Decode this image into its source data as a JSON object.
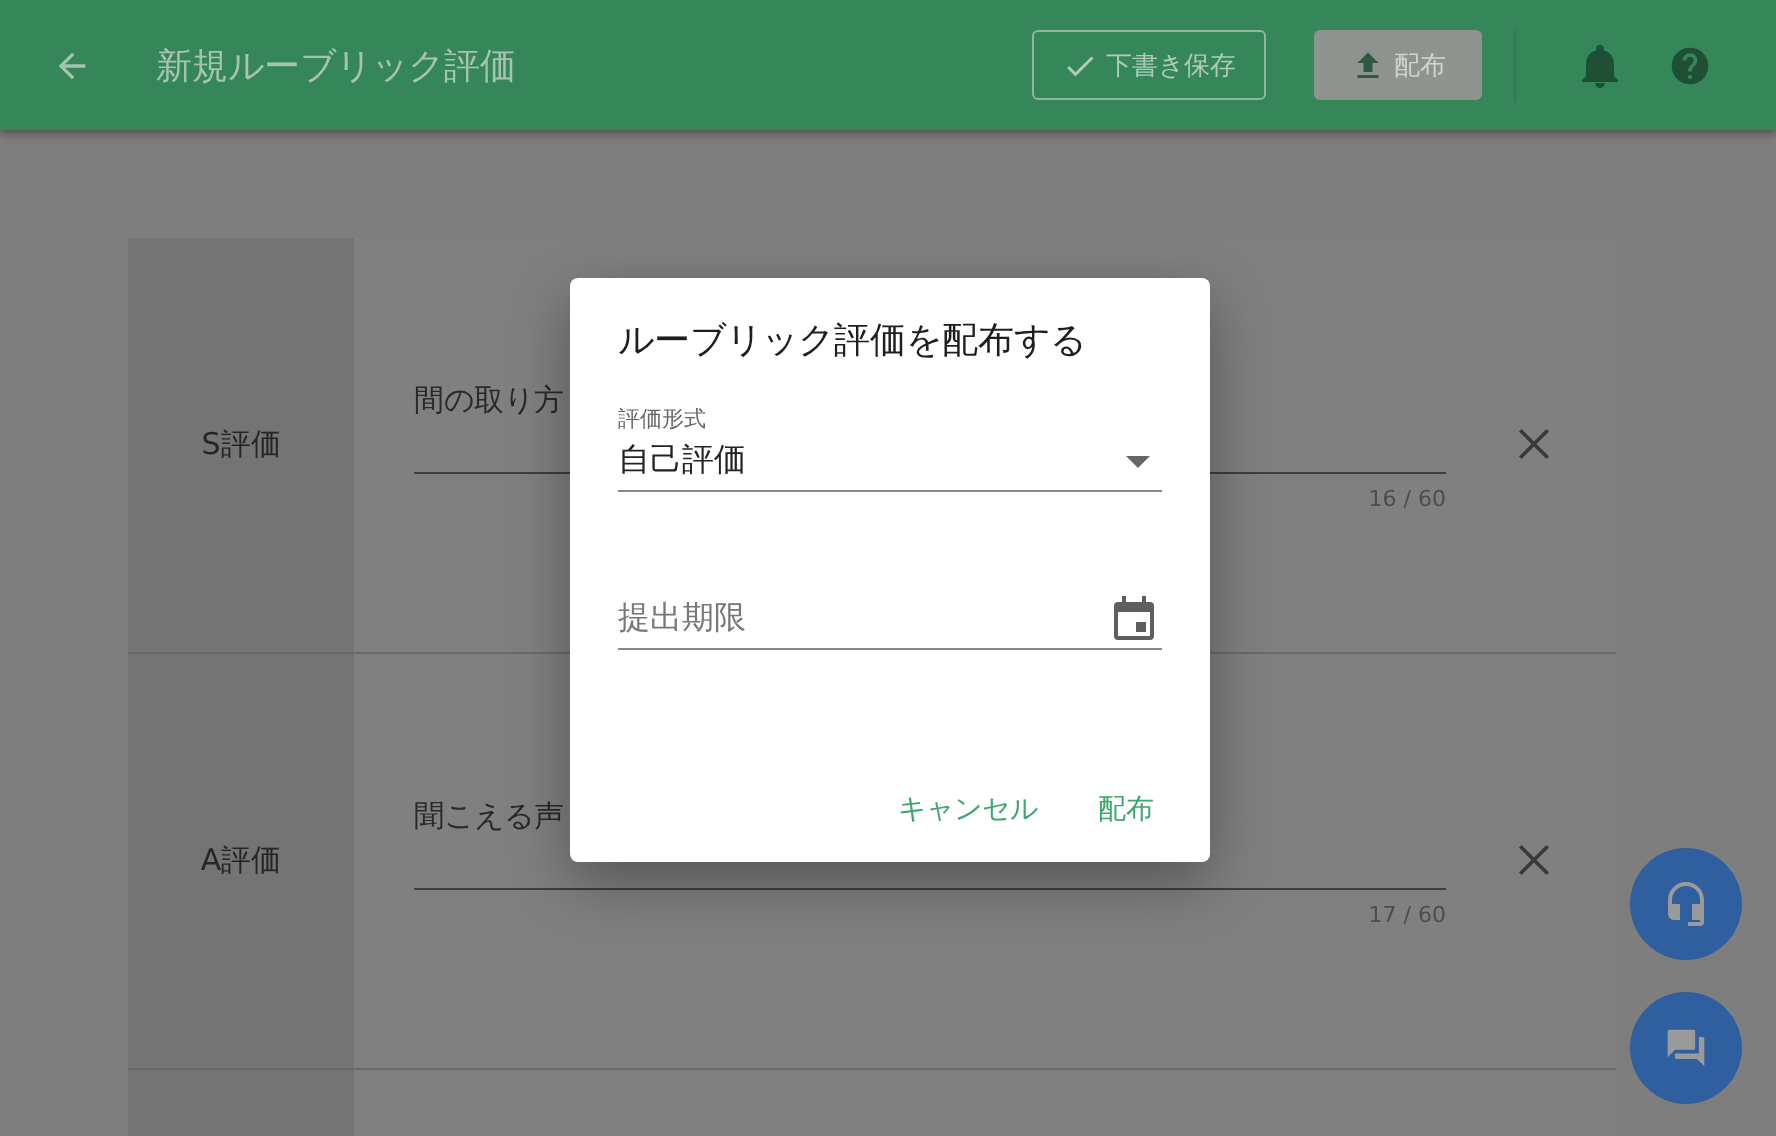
{
  "app_bar": {
    "title": "新規ルーブリック評価",
    "actions": [
      {
        "kind": "outlined",
        "label": "下書き保存"
      },
      {
        "kind": "filled",
        "label": "配布"
      }
    ]
  },
  "rubric_rows": [
    {
      "grade": "S評価",
      "value": "間の取り方",
      "counter": "16 / 60"
    },
    {
      "grade": "A評価",
      "value": "聞こえる声",
      "counter": "17 / 60"
    }
  ],
  "dialog": {
    "title": "ルーブリック評価を配布する",
    "fields": [
      {
        "kind": "select",
        "label": "評価形式",
        "value": "自己評価"
      },
      {
        "kind": "date",
        "placeholder": "提出期限"
      }
    ],
    "buttons": [
      "キャンセル",
      "配布"
    ]
  }
}
